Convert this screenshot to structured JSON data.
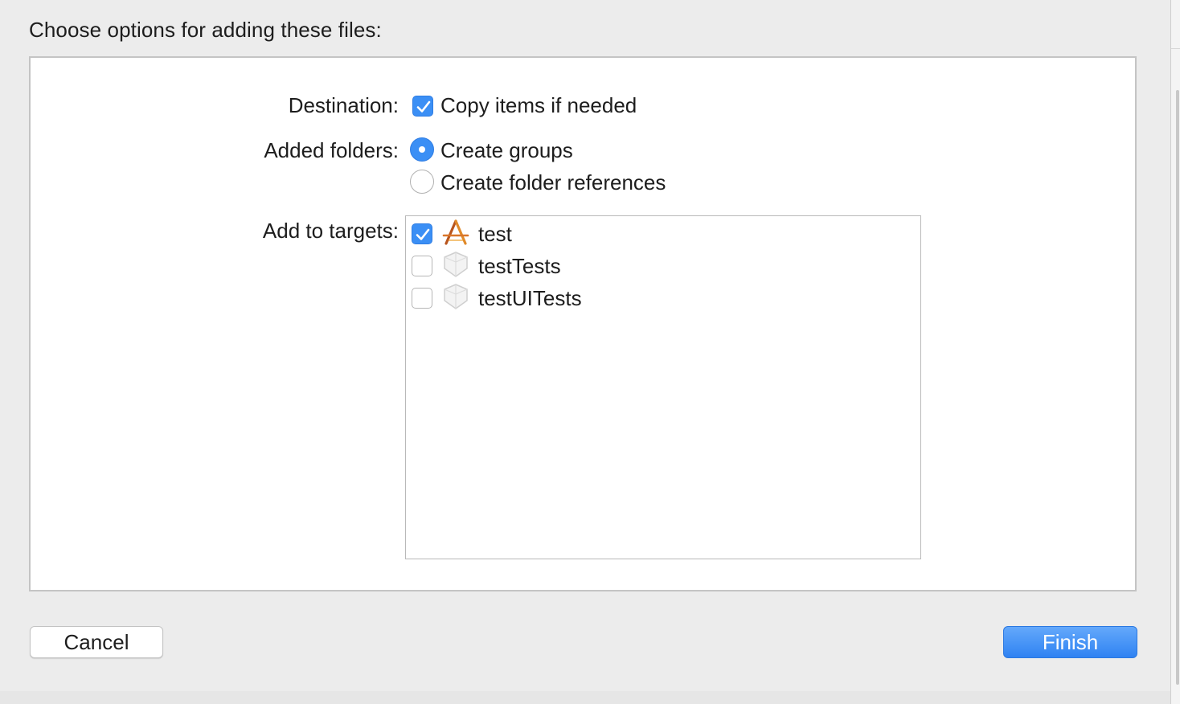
{
  "dialog": {
    "title": "Choose options for adding these files:"
  },
  "destination": {
    "label": "Destination:",
    "copy_items": {
      "label": "Copy items if needed",
      "checked": true
    }
  },
  "added_folders": {
    "label": "Added folders:",
    "options": [
      {
        "label": "Create groups",
        "selected": true
      },
      {
        "label": "Create folder references",
        "selected": false
      }
    ]
  },
  "targets": {
    "label": "Add to targets:",
    "items": [
      {
        "name": "test",
        "checked": true,
        "icon": "app-target-icon"
      },
      {
        "name": "testTests",
        "checked": false,
        "icon": "test-bundle-icon"
      },
      {
        "name": "testUITests",
        "checked": false,
        "icon": "test-bundle-icon"
      }
    ]
  },
  "buttons": {
    "cancel": "Cancel",
    "finish": "Finish"
  },
  "colors": {
    "accent": "#3b8ff5",
    "background": "#ececec"
  }
}
